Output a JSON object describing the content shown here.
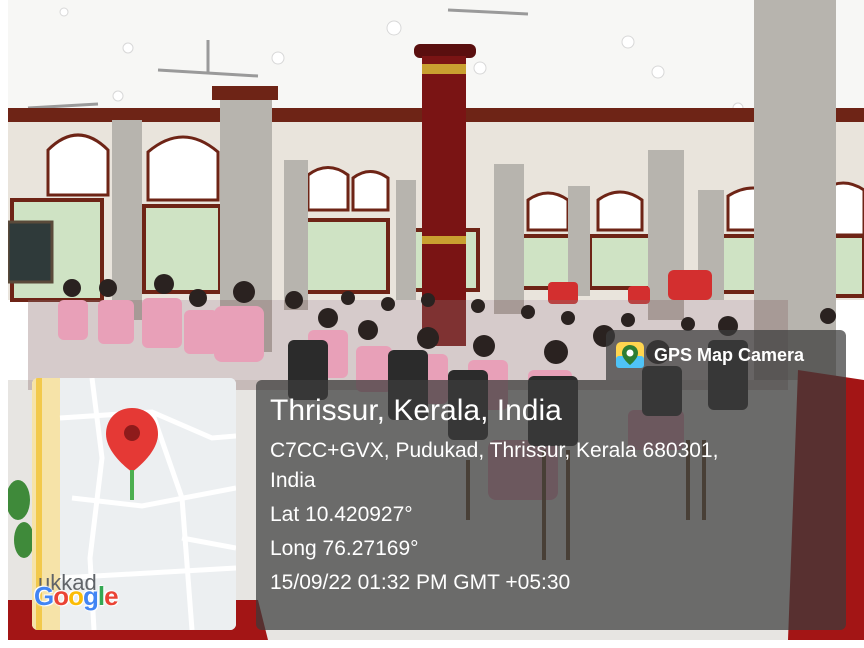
{
  "badge": {
    "label": "GPS Map Camera",
    "icon": "map-pin-icon"
  },
  "location": {
    "title": "Thrissur, Kerala, India",
    "address_line1": "C7CC+GVX, Pudukad, Thrissur, Kerala 680301,",
    "address_line2": "India",
    "lat": "Lat 10.420927°",
    "long": "Long 76.27169°",
    "datetime": "15/09/22 01:32 PM GMT +05:30"
  },
  "map": {
    "place_label": "ukkad",
    "logo": [
      "G",
      "o",
      "o",
      "g",
      "l",
      "e"
    ],
    "pin_color": "#E53935"
  },
  "colors": {
    "panel_bg": "rgba(60,60,60,0.72)",
    "uniform_pink": "#E8A0B8",
    "pillar_red": "#7A1414",
    "floor_red": "#A31515"
  }
}
